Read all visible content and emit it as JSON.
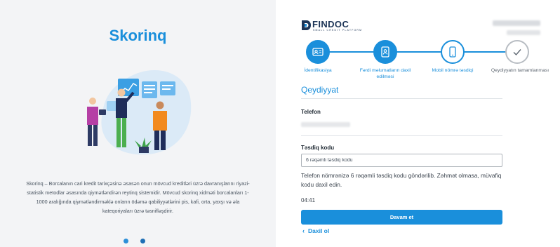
{
  "left": {
    "title": "Skorinq",
    "description": "Skorinq – Borcalanın cari kredit tarixçəsinə əsasən onun mövcud kreditləri üzrə davranışlarını riyazi-statistik metodlar əsasında qiymətləndirən reytinq sistemidir. Mövcud skorinq xidməti borcalanları 1-1000 aralığında qiymətləndirməklə onların ödəmə qabiliyyətlərini pis, kafi, orta, yaxşı və əla kateqoriyaları üzrə təsnifləşdirir.",
    "carousel": {
      "total": 2,
      "active": 1
    }
  },
  "brand": {
    "name": "FINDOC",
    "tagline": "SMALL CREDIT PLATFORM",
    "color": "#1a8fdb"
  },
  "stepper": {
    "steps": [
      {
        "label": "İdentifikasiya",
        "state": "done",
        "icon": "id-card-icon"
      },
      {
        "label": "Fərdi məlumatların daxil edilməsi",
        "state": "done",
        "icon": "user-badge-icon"
      },
      {
        "label": "Mobil nömrə təsdiqi",
        "state": "current",
        "icon": "mobile-phone-icon"
      },
      {
        "label": "Qeydiyyatın tamamlanması",
        "state": "pending",
        "icon": "checkmark-icon"
      }
    ]
  },
  "form": {
    "section_title": "Qeydiyyat",
    "phone_label": "Telefon",
    "code_label": "Təsdiq kodu",
    "code_placeholder": "6 rəqəmli təsdiq kodu",
    "info_text": "Telefon nömrənizə 6 rəqəmli təsdiq kodu göndərilib. Zəhmət olmasa, müvafiq kodu daxil edin.",
    "timer": "04:41",
    "submit_label": "Davam et",
    "back_label": "Daxil ol"
  }
}
